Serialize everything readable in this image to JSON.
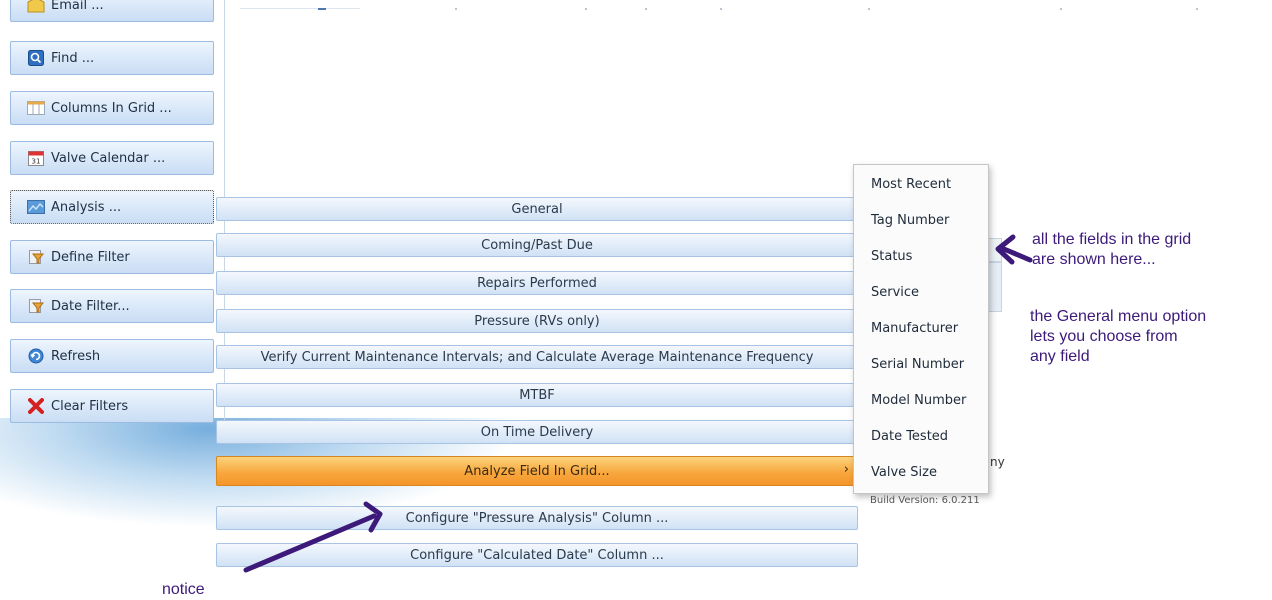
{
  "sidebar": {
    "items": [
      {
        "label": "Email ...",
        "icon": "envelope-icon"
      },
      {
        "label": "Find ...",
        "icon": "search-icon"
      },
      {
        "label": "Columns In Grid ...",
        "icon": "columns-icon"
      },
      {
        "label": "Valve Calendar ...",
        "icon": "calendar-icon"
      },
      {
        "label": "Analysis ...",
        "icon": "chart-icon"
      },
      {
        "label": "Define Filter",
        "icon": "filter-icon"
      },
      {
        "label": "Date Filter...",
        "icon": "filter-icon"
      },
      {
        "label": "Refresh",
        "icon": "refresh-icon"
      },
      {
        "label": "Clear Filters",
        "icon": "clear-x-icon"
      }
    ]
  },
  "analysis_menu": {
    "items": [
      {
        "label": "General"
      },
      {
        "label": "Coming/Past Due"
      },
      {
        "label": "Repairs Performed"
      },
      {
        "label": "Pressure (RVs only)"
      },
      {
        "label": "Verify Current Maintenance Intervals; and Calculate Average Maintenance Frequency"
      },
      {
        "label": "MTBF"
      },
      {
        "label": "On Time Delivery"
      },
      {
        "label": "Analyze Field In Grid..."
      },
      {
        "label": "Configure \"Pressure Analysis\" Column ..."
      },
      {
        "label": "Configure \"Calculated Date\" Column ..."
      }
    ],
    "submenu_arrow": "›"
  },
  "field_submenu": {
    "items": [
      "Most Recent",
      "Tag Number",
      "Status",
      "Service",
      "Manufacturer",
      "Serial Number",
      "Model Number",
      "Date Tested",
      "Valve Size"
    ]
  },
  "background": {
    "partial_text": "ny",
    "build_version": "Build Version: 6.0.211"
  },
  "annotations": {
    "note_fields_line1": "all the fields in the grid",
    "note_fields_line2": "are shown here...",
    "note_general_line1": "the General menu option",
    "note_general_line2": "lets you choose from",
    "note_general_line3": "any field",
    "note_notice": "notice"
  },
  "colors": {
    "button_blue": "#dbe9f9",
    "highlight_orange": "#f8a83e",
    "annotation_purple": "#3d1a7a"
  }
}
